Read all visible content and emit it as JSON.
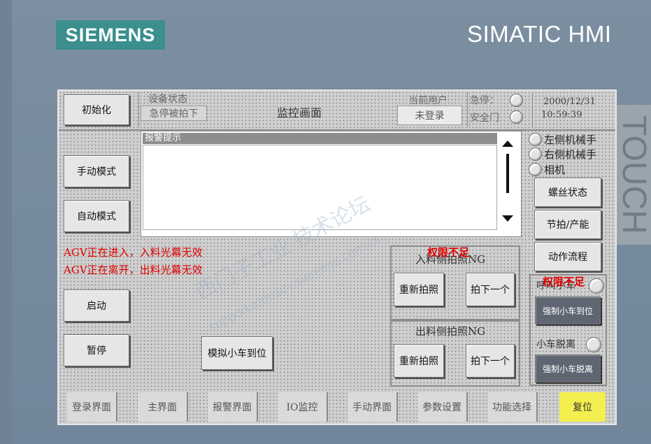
{
  "frame": {
    "brand": "SIEMENS",
    "product": "SIMATIC HMI",
    "side_text": "TOUCH"
  },
  "header": {
    "init_button": "初始化",
    "device_status_label": "设备状态",
    "device_status_value": "急停被拍下",
    "screen_title": "监控画面",
    "current_user_label": "当前用户",
    "current_user_value": "未登录",
    "estop_label": "急停：",
    "safety_door_label": "安全门",
    "date": "2000/12/31",
    "time": "10:59:39"
  },
  "left_buttons": {
    "manual_mode": "手动模式",
    "auto_mode": "自动模式",
    "start": "启动",
    "pause": "暂停"
  },
  "alarm": {
    "title": "报警提示"
  },
  "status_messages": [
    "AGV正在进入，入料光幕无效",
    "AGV正在离开，出料光幕无效"
  ],
  "simulate_button": "模拟小车到位",
  "infeed_panel": {
    "title": "入料侧拍照NG",
    "warning": "权限不足",
    "retake": "重新拍照",
    "next": "拍下一个"
  },
  "outfeed_panel": {
    "title": "出料侧拍照NG",
    "retake": "重新拍照",
    "next": "拍下一个"
  },
  "right_indicators": {
    "left_robot": "左侧机械手",
    "right_robot": "右侧机械手",
    "camera": "相机"
  },
  "right_buttons": {
    "screw_status": "螺丝状态",
    "cycle_output": "节拍/产能",
    "action_flow": "动作流程"
  },
  "cart_panel": {
    "call_cart": "呼叫小车",
    "warning": "权限不足",
    "force_cart_arrive": "强制小车到位",
    "cart_leave": "小车脱离",
    "force_cart_leave": "强制小车脱离"
  },
  "nav_tabs": [
    "登录界面",
    "主界面",
    "报警界面",
    "IO监控",
    "手动界面",
    "参数设置",
    "功能选择",
    "复位"
  ],
  "watermark": {
    "line1": "西门子工业  技术论坛",
    "line2": "support.industry.siemens.com/cs"
  },
  "colors": {
    "bezel": "#71869a",
    "logo_bg": "#3b8f8f",
    "warning_red": "#e00000",
    "reset_yellow": "#f4ef4e",
    "dark_button": "#5f6672"
  }
}
